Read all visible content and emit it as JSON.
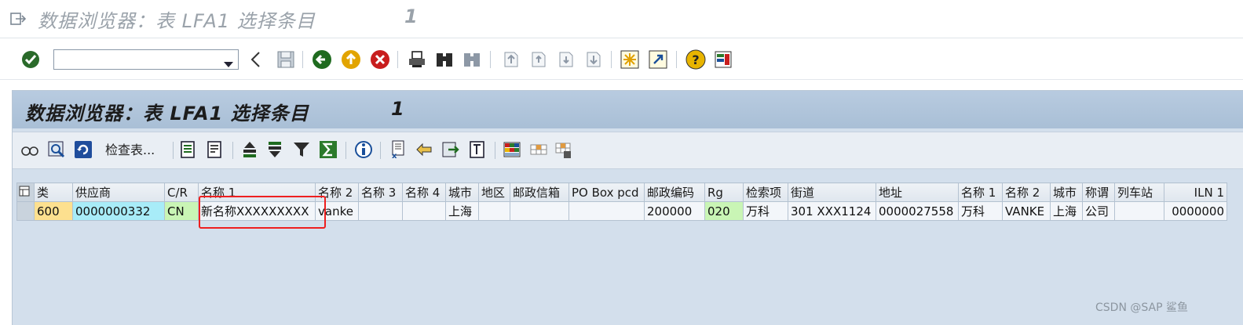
{
  "window": {
    "title": "数据浏览器：表 LFA1 选择条目",
    "count": "1"
  },
  "system_toolbar": {
    "command_field_value": "",
    "icons": [
      "enter-check-icon",
      "command-dropdown-icon",
      "back-arrow-icon",
      "save-icon",
      "back-icon",
      "exit-icon",
      "cancel-icon",
      "print-icon",
      "find-icon",
      "find-next-icon",
      "first-page-icon",
      "previous-page-icon",
      "next-page-icon",
      "last-page-icon",
      "create-session-icon",
      "create-shortcut-icon",
      "help-icon",
      "customize-layout-icon"
    ]
  },
  "page": {
    "title": "数据浏览器：表 LFA1 选择条目",
    "count": "1"
  },
  "app_toolbar": {
    "check_table_label": "检查表..."
  },
  "table": {
    "columns": [
      "类",
      "供应商",
      "C/R",
      "名称 1",
      "名称 2",
      "名称 3",
      "名称 4",
      "城市",
      "地区",
      "邮政信箱",
      "PO Box pcd",
      "邮政编码",
      "Rg",
      "检索项",
      "街道",
      "地址",
      "名称 1",
      "名称 2",
      "城市",
      "称谓",
      "列车站",
      "ILN 1"
    ],
    "rows": [
      [
        "600",
        "0000000332",
        "CN",
        "新名称XXXXXXXXX",
        "vanke",
        "",
        "",
        "上海",
        "",
        "",
        "",
        "200000",
        "020",
        "万科",
        "301 XXX1124",
        "0000027558",
        "万科",
        "VANKE",
        "上海",
        "公司",
        "",
        "0000000"
      ]
    ]
  },
  "colors": {
    "key_cell": "#fde08f",
    "supplier_cell": "#a8ecf8",
    "green_cell": "#c9f5b5",
    "highlight_border": "#ee1f1f",
    "header_band": "#b8cbe0"
  },
  "watermark": "CSDN @SAP  鲨鱼"
}
